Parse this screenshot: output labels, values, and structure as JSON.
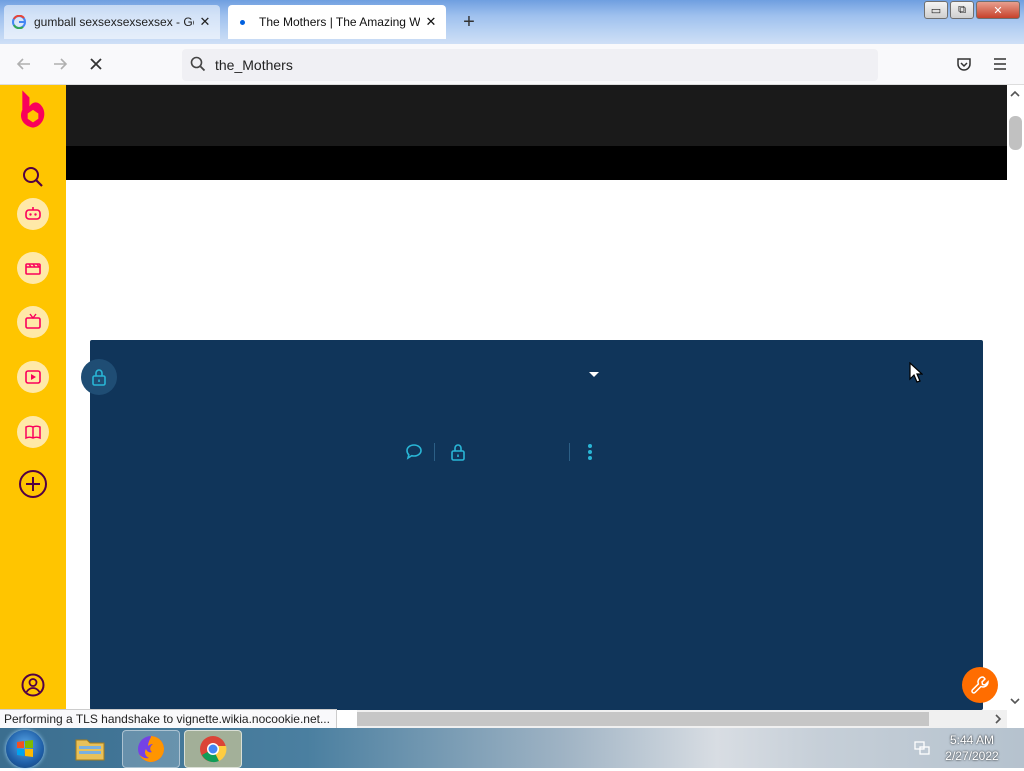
{
  "browser": {
    "tabs": [
      {
        "label": "gumball sexsexsexsexsex - Goog",
        "favicon": "google-g-icon"
      },
      {
        "label": "The Mothers | The Amazing Wo",
        "favicon": "loading-dot-icon"
      }
    ],
    "new_tab_symbol": "+",
    "window_controls": {
      "minimize": "▭",
      "maximize": "⧉",
      "close": "✕"
    },
    "url": "the_Mothers",
    "status_text": "Performing a TLS handshake to vignette.wikia.nocookie.net..."
  },
  "sidebar": {
    "items": [
      {
        "icon": "fandom-flame-logo"
      },
      {
        "icon": "search-icon"
      },
      {
        "icon": "games-controller-icon"
      },
      {
        "icon": "movies-clapperboard-icon"
      },
      {
        "icon": "tv-icon"
      },
      {
        "icon": "video-play-icon"
      },
      {
        "icon": "book-icon"
      },
      {
        "icon": "plus-circle-icon"
      },
      {
        "icon": "account-icon"
      }
    ]
  },
  "taskbar": {
    "apps": [
      "windows-explorer-icon",
      "firefox-icon",
      "chrome-icon"
    ],
    "time": "5:44 AM",
    "date": "2/27/2022"
  },
  "colors": {
    "sidebar": "#ffc500",
    "panel": "#10355a",
    "accent": "#29b6d6",
    "wrench": "#ff6d00",
    "fandom": "#fa005a"
  }
}
